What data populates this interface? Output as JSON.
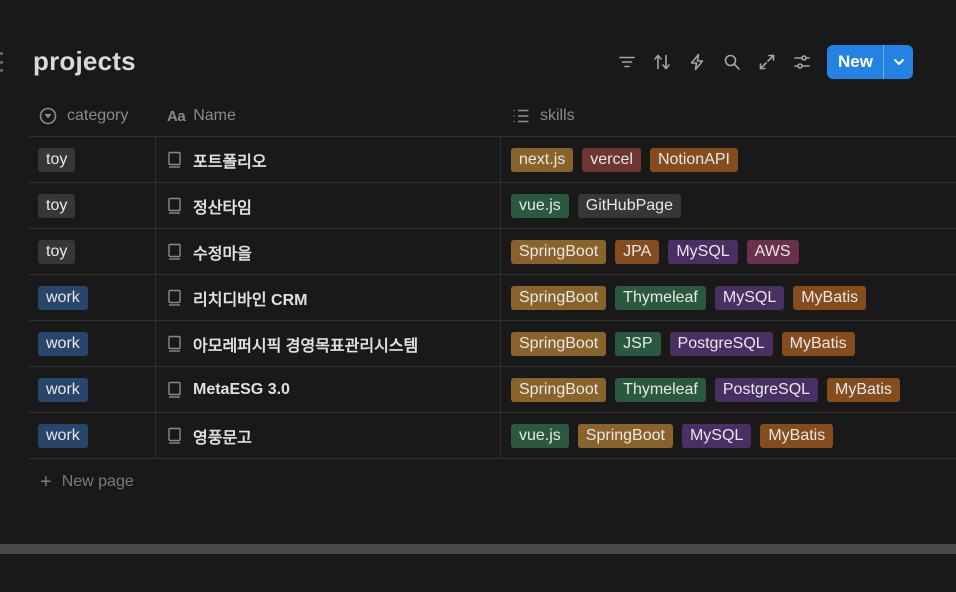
{
  "database": {
    "title": "projects"
  },
  "toolbar": {
    "icons": [
      "filter-icon",
      "sort-icon",
      "automation-icon",
      "search-icon",
      "expand-icon",
      "settings-icon"
    ],
    "new_label": "New"
  },
  "columns": {
    "category": "category",
    "name": "Name",
    "skills": "skills",
    "name_type_glyph": "Aa"
  },
  "rows": [
    {
      "category": {
        "label": "toy",
        "color": "gray"
      },
      "name": "포트폴리오",
      "skills": [
        {
          "label": "next.js",
          "color": "yellow"
        },
        {
          "label": "vercel",
          "color": "red"
        },
        {
          "label": "NotionAPI",
          "color": "orange"
        }
      ]
    },
    {
      "category": {
        "label": "toy",
        "color": "gray"
      },
      "name": "정산타임",
      "skills": [
        {
          "label": "vue.js",
          "color": "green"
        },
        {
          "label": "GitHubPage",
          "color": "gray"
        }
      ]
    },
    {
      "category": {
        "label": "toy",
        "color": "gray"
      },
      "name": "수정마을",
      "skills": [
        {
          "label": "SpringBoot",
          "color": "yellow"
        },
        {
          "label": "JPA",
          "color": "orange"
        },
        {
          "label": "MySQL",
          "color": "purple"
        },
        {
          "label": "AWS",
          "color": "pink"
        }
      ]
    },
    {
      "category": {
        "label": "work",
        "color": "blue"
      },
      "name": "리치디바인 CRM",
      "skills": [
        {
          "label": "SpringBoot",
          "color": "yellow"
        },
        {
          "label": "Thymeleaf",
          "color": "green"
        },
        {
          "label": "MySQL",
          "color": "purple"
        },
        {
          "label": "MyBatis",
          "color": "orange"
        }
      ]
    },
    {
      "category": {
        "label": "work",
        "color": "blue"
      },
      "name": "아모레퍼시픽 경영목표관리시스템",
      "skills": [
        {
          "label": "SpringBoot",
          "color": "yellow"
        },
        {
          "label": "JSP",
          "color": "green"
        },
        {
          "label": "PostgreSQL",
          "color": "purple"
        },
        {
          "label": "MyBatis",
          "color": "orange"
        }
      ]
    },
    {
      "category": {
        "label": "work",
        "color": "blue"
      },
      "name": "MetaESG 3.0",
      "skills": [
        {
          "label": "SpringBoot",
          "color": "yellow"
        },
        {
          "label": "Thymeleaf",
          "color": "green"
        },
        {
          "label": "PostgreSQL",
          "color": "purple"
        },
        {
          "label": "MyBatis",
          "color": "orange"
        }
      ]
    },
    {
      "category": {
        "label": "work",
        "color": "blue"
      },
      "name": "영풍문고",
      "skills": [
        {
          "label": "vue.js",
          "color": "green"
        },
        {
          "label": "SpringBoot",
          "color": "yellow"
        },
        {
          "label": "MySQL",
          "color": "purple"
        },
        {
          "label": "MyBatis",
          "color": "orange"
        }
      ]
    }
  ],
  "footer": {
    "new_page_label": "New page"
  },
  "colors": {
    "background": "#191919",
    "accent": "#2383e2"
  }
}
